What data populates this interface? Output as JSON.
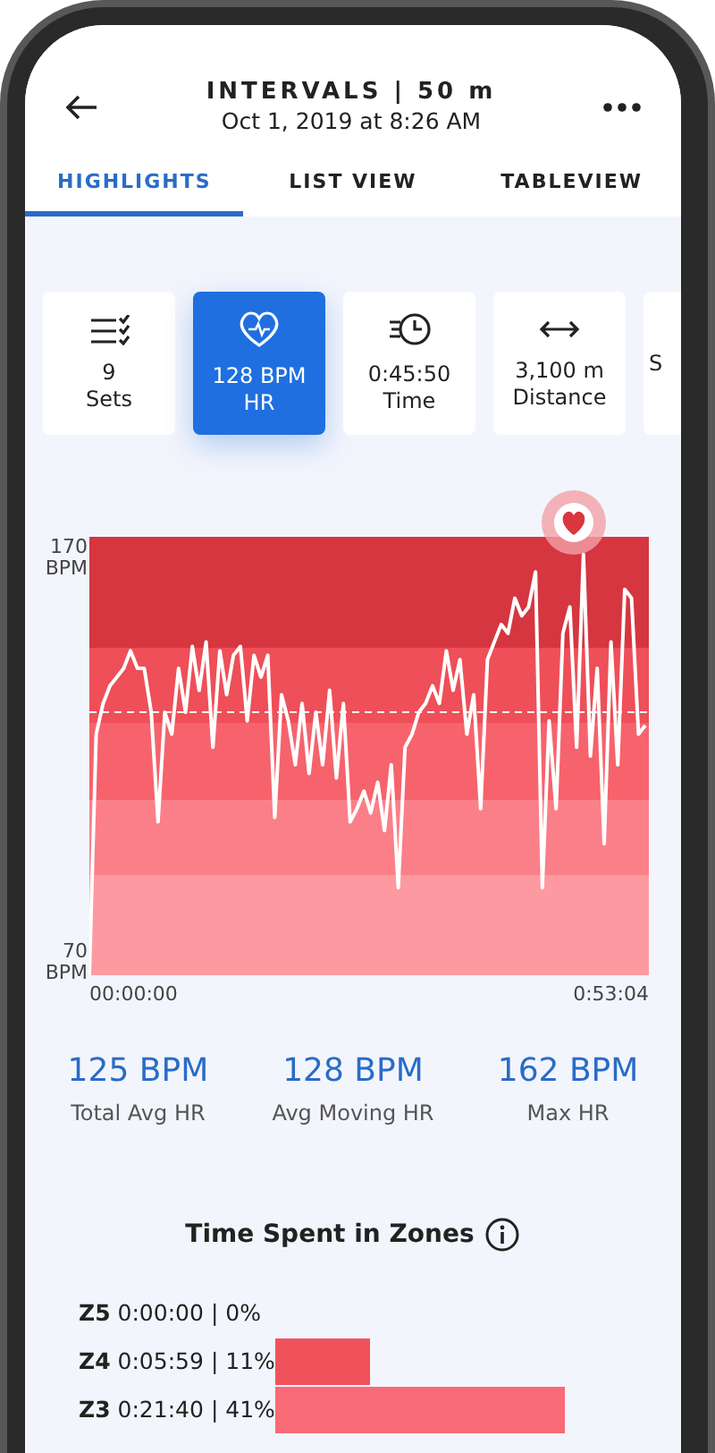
{
  "header": {
    "title": "INTERVALS | 50 m",
    "subtitle": "Oct 1, 2019 at 8:26 AM"
  },
  "tabs": [
    {
      "label": "HIGHLIGHTS",
      "selected": true
    },
    {
      "label": "LIST VIEW",
      "selected": false
    },
    {
      "label": "TABLEVIEW",
      "selected": false
    }
  ],
  "summary_cards": [
    {
      "kind": "sets",
      "value": "9",
      "label": "Sets",
      "selected": false
    },
    {
      "kind": "heart",
      "value": "128 BPM",
      "label": "HR",
      "selected": true
    },
    {
      "kind": "time",
      "value": "0:45:50",
      "label": "Time",
      "selected": false
    },
    {
      "kind": "distance",
      "value": "3,100 m",
      "label": "Distance",
      "selected": false
    },
    {
      "kind": "other",
      "value": "S",
      "selected": false
    }
  ],
  "hr_chart": {
    "y_top": "170\nBPM",
    "y_bottom": "70\nBPM",
    "x_start": "00:00:00",
    "x_end": "0:53:04"
  },
  "stats": [
    {
      "value": "125 BPM",
      "label": "Total Avg HR"
    },
    {
      "value": "128 BPM",
      "label": "Avg Moving HR"
    },
    {
      "value": "162 BPM",
      "label": "Max HR"
    }
  ],
  "zones": {
    "title": "Time Spent in Zones",
    "rows": [
      {
        "zone": "Z5",
        "time": "0:00:00",
        "percent": "| 0%"
      },
      {
        "zone": "Z4",
        "time": "0:05:59",
        "percent": "| 11%"
      },
      {
        "zone": "Z3",
        "time": "0:21:40",
        "percent": "| 41%"
      }
    ]
  }
}
